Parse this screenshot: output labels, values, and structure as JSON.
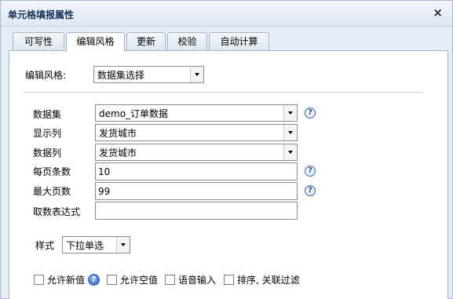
{
  "dialog": {
    "title": "单元格填报属性",
    "close_glyph": "×"
  },
  "tabs": [
    {
      "label": "可写性",
      "active": false
    },
    {
      "label": "编辑风格",
      "active": true
    },
    {
      "label": "更新",
      "active": false
    },
    {
      "label": "校验",
      "active": false
    },
    {
      "label": "自动计算",
      "active": false
    }
  ],
  "edit_style": {
    "label": "编辑风格:",
    "value": "数据集选择"
  },
  "fields": {
    "dataset": {
      "label": "数据集",
      "value": "demo_订单数据"
    },
    "display_column": {
      "label": "显示列",
      "value": "发货城市"
    },
    "data_column": {
      "label": "数据列",
      "value": "发货城市"
    },
    "page_size": {
      "label": "每页条数",
      "value": "10"
    },
    "max_pages": {
      "label": "最大页数",
      "value": "99"
    },
    "fetch_expression": {
      "label": "取数表达式",
      "value": ""
    }
  },
  "style": {
    "label": "样式",
    "value": "下拉单选"
  },
  "checkboxes": {
    "allow_new": "允许新值",
    "allow_empty": "允许空值",
    "voice_input": "语音输入",
    "sort_filter": "排序, 关联过滤"
  },
  "help_glyph": "?"
}
